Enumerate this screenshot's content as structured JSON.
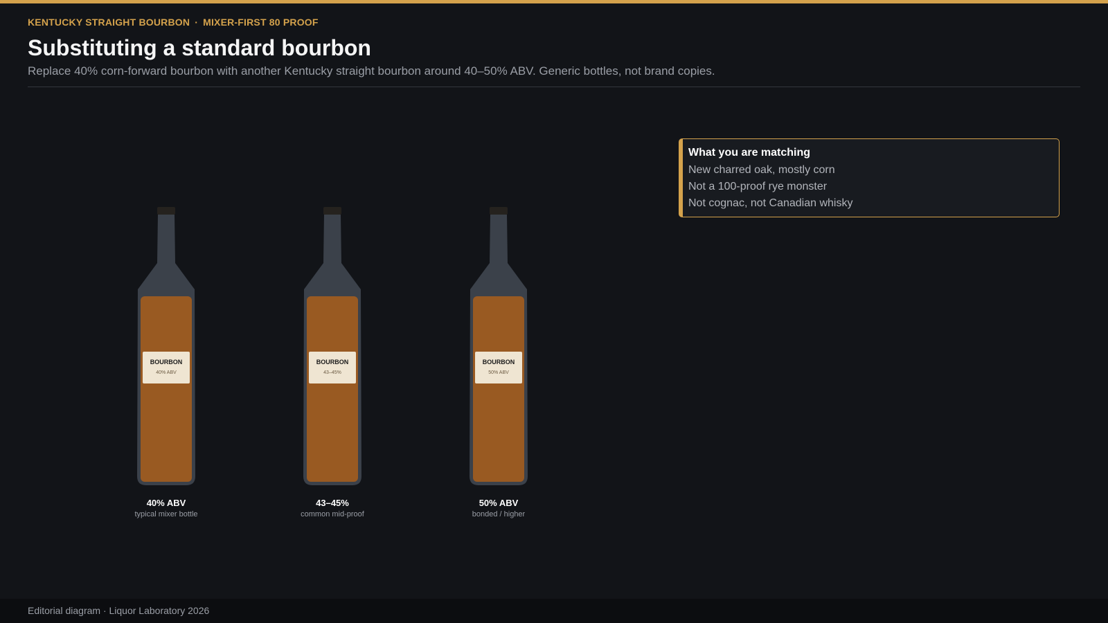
{
  "header": {
    "kicker_left": "KENTUCKY STRAIGHT BOURBON",
    "kicker_sep": "·",
    "kicker_right": "MIXER-FIRST 80 PROOF",
    "title": "Substituting a standard bourbon",
    "subtitle": "Replace 40% corn-forward bourbon with another Kentucky straight bourbon around 40–50% ABV. Generic bottles, not brand copies."
  },
  "bottles": [
    {
      "label_name": "BOURBON",
      "label_abv": "40% ABV",
      "caption": "40% ABV",
      "subcaption": "typical mixer bottle"
    },
    {
      "label_name": "BOURBON",
      "label_abv": "43–45%",
      "caption": "43–45%",
      "subcaption": "common mid-proof"
    },
    {
      "label_name": "BOURBON",
      "label_abv": "50% ABV",
      "caption": "50% ABV",
      "subcaption": "bonded / higher"
    }
  ],
  "matching": {
    "title": "What you are matching",
    "items": [
      "New charred oak, mostly corn",
      "Not a 100-proof rye monster",
      "Not cognac, not Canadian whisky"
    ]
  },
  "footer": {
    "text": "Editorial diagram · Liquor Laboratory 2026"
  },
  "colors": {
    "accent": "#d4a24c",
    "background": "#121418",
    "bottle_glass": "#3b414a",
    "bourbon_liquid": "#995a22",
    "label_paper": "#efe5d2",
    "cap": "#25221e"
  }
}
